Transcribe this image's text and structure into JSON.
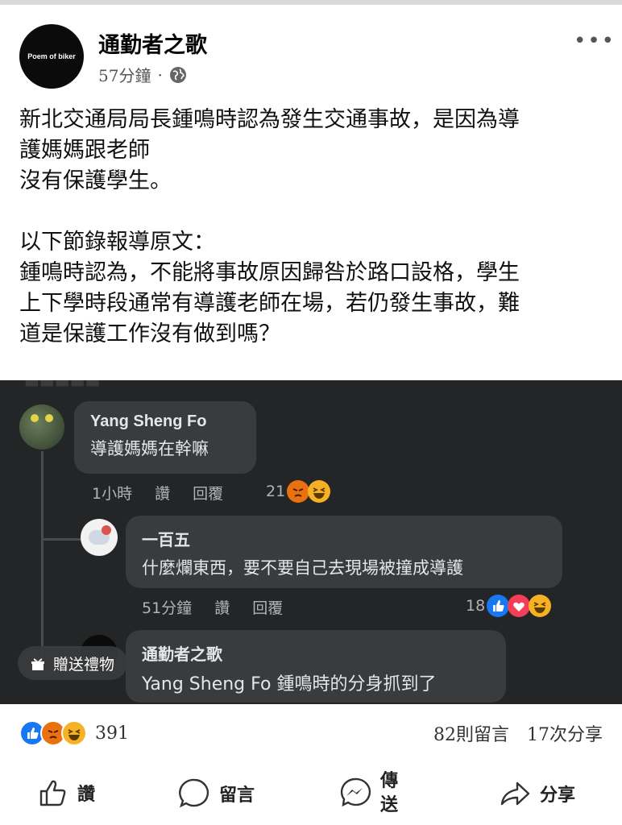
{
  "post": {
    "page_name": "通勤者之歌",
    "avatar_text": "Poem of biker",
    "time": "57分鐘",
    "dot": "·",
    "more": "•••",
    "body": "新北交通局局長鍾鳴時認為發生交通事故，是因為導\n護媽媽跟老師\n沒有保護學生。\n\n以下節錄報導原文：\n鍾鳴時認為，不能將事故原因歸咎於路口設格，學生\n上下學時段通常有導護老師在場，若仍發生事故，難\n道是保護工作沒有做到嗎？"
  },
  "screenshot": {
    "comments": [
      {
        "author": "Yang Sheng Fo",
        "text": "導護媽媽在幹嘛",
        "time": "1小時",
        "like": "讚",
        "reply": "回覆",
        "reaction_count": "21"
      },
      {
        "author": "一百五",
        "text": "什麼爛東西，要不要自己去現場被撞成導護",
        "time": "51分鐘",
        "like": "讚",
        "reply": "回覆",
        "reaction_count": "18"
      },
      {
        "author": "通勤者之歌",
        "text": "Yang Sheng Fo 鍾鳴時的分身抓到了"
      }
    ],
    "gift_label": "贈送禮物"
  },
  "footer": {
    "reaction_total": "391",
    "comments_count": "82則留言",
    "shares_count": "17次分享",
    "like_label": "讚",
    "comment_label": "留言",
    "send_label": "傳\n送",
    "share_label": "分享"
  },
  "colors": {
    "like_blue": "#1877f2",
    "love_red": "#f33e58",
    "angry_orange": "#e9710f",
    "haha_yellow": "#f7b125",
    "dark_bg": "#242526",
    "bubble": "#3a3b3c"
  },
  "icons": [
    "more-icon",
    "globe-icon",
    "like-icon",
    "angry-icon",
    "haha-icon",
    "love-icon",
    "gift-icon",
    "thumb-outline-icon",
    "comment-outline-icon",
    "messenger-icon",
    "share-outline-icon"
  ]
}
